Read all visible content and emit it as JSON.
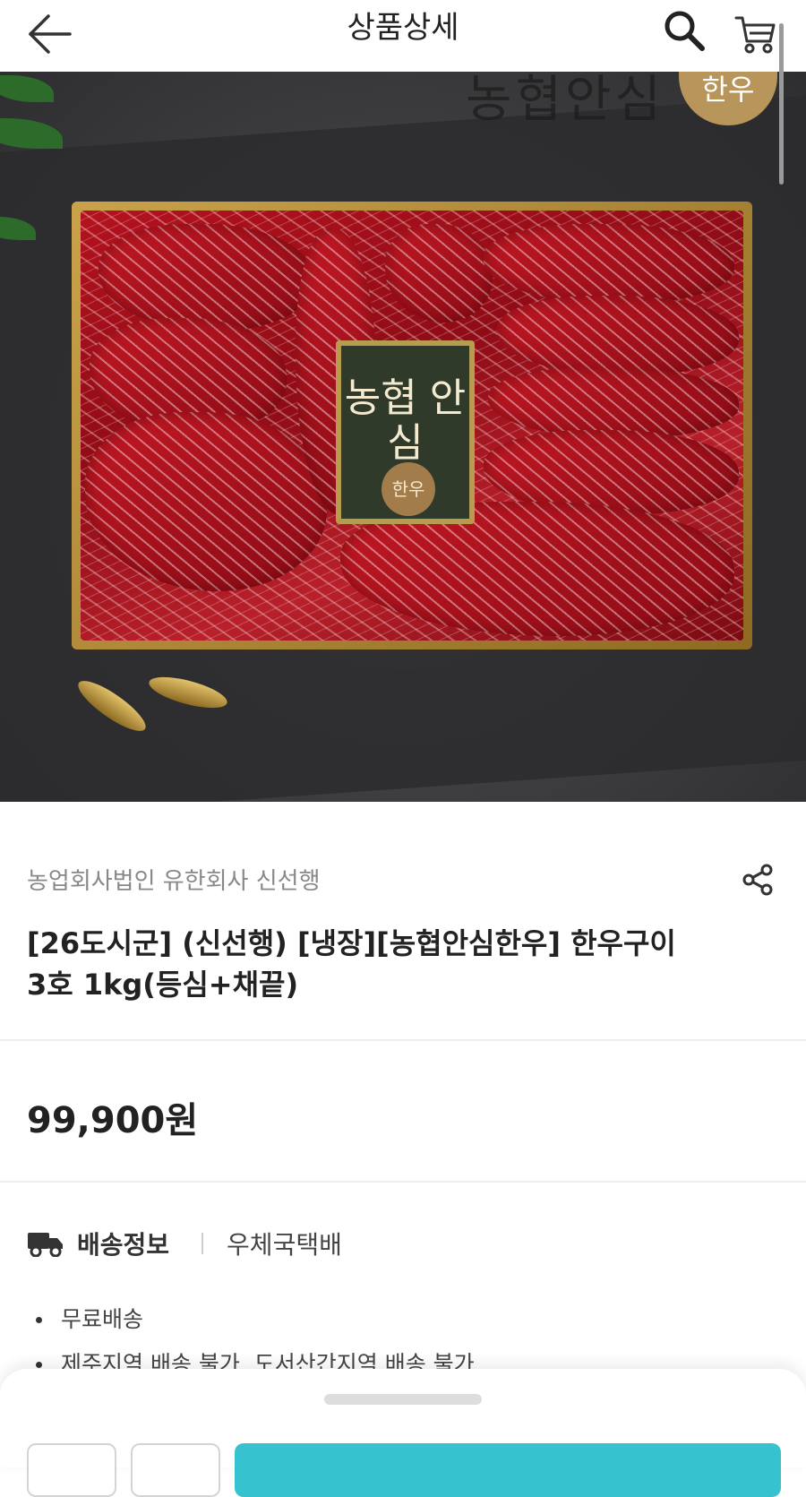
{
  "header": {
    "title": "상품상세",
    "back_icon": "arrow-left-icon",
    "search_icon": "search-icon",
    "cart_icon": "cart-icon"
  },
  "hero": {
    "image": "korean-beef-gift-set-photo",
    "label_main": "농협 안심",
    "label_sub": "한우",
    "brand_text": "농협안심",
    "brand_badge": "한우"
  },
  "product": {
    "seller": "농업회사법인 유한회사 신선행",
    "title": "[26도시군] (신선행) [냉장][농협안심한우] 한우구이 3호 1kg(등심+채끝)",
    "price": "99,900원",
    "share_icon": "share-icon"
  },
  "delivery": {
    "title": "배송정보",
    "method": "우체국택배",
    "icon": "truck-icon",
    "items": [
      "무료배송",
      "제주지역 배송 불가, 도서산간지역 배송 불가"
    ]
  },
  "colors": {
    "accent": "#37c2cf",
    "text_primary": "#222222",
    "text_secondary": "#888888",
    "divider": "#eeeeee"
  }
}
